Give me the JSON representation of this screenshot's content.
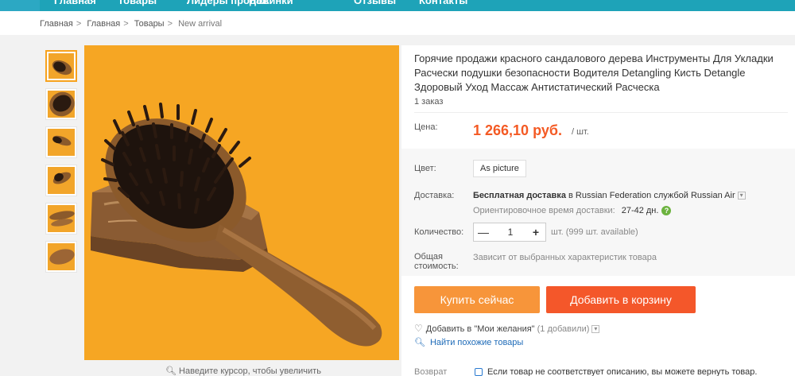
{
  "nav": {
    "items": [
      "Главная",
      "Товары",
      "Лидеры продаж",
      "Новинки",
      "Отзывы",
      "Контакты"
    ]
  },
  "breadcrumb": [
    "Главная",
    "Главная",
    "Товары",
    "New arrival"
  ],
  "gallery": {
    "zoom_hint": "Наведите курсор, чтобы увеличить"
  },
  "product": {
    "title": "Горячие продажи красного сандалового дерева Инструменты Для Укладки Расчески подушки безопасности Водителя Detangling Кисть Detangle Здоровый Уход Массаж Антистатический Расческа",
    "orders": "1 заказ",
    "price_label": "Цена:",
    "price": "1 266,10 руб.",
    "unit": "/ шт.",
    "color_label": "Цвет:",
    "color_value": "As picture",
    "shipping_label": "Доставка:",
    "shipping_bold": "Бесплатная доставка",
    "shipping_rest": "в Russian Federation службой Russian Air",
    "est_label": "Ориентировочное время доставки:",
    "est_days": "27-42 дн.",
    "qty_label": "Количество:",
    "qty_value": "1",
    "qty_info": "шт. (999 шт. available)",
    "total_label_1": "Общая",
    "total_label_2": "стоимость:",
    "total_value": "Зависит от выбранных характеристик товара",
    "buy_now": "Купить сейчас",
    "add_to_cart": "Добавить в корзину",
    "wishlist": "Добавить в \"Мои желания\"",
    "wishlist_count": "(1 добавили)",
    "similar": "Найти похожие товары",
    "returns_label": "Возврат",
    "returns_text": "Если товар не соответствует описанию, вы можете вернуть товар."
  },
  "colors": {
    "accent_orange": "#f7953a",
    "accent_red": "#f4572a",
    "price": "#f45a24",
    "nav": "#1ea3b8",
    "link": "#1e6bb8"
  }
}
